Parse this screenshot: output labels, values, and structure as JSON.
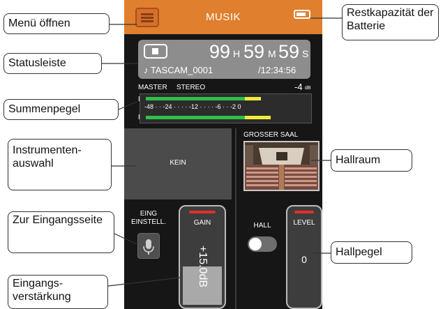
{
  "header": {
    "title": "MUSIK",
    "battery_fill": 0.8
  },
  "status": {
    "hours": "99",
    "hours_unit": "H",
    "minutes": "59",
    "minutes_unit": "M",
    "seconds": "59",
    "seconds_unit": "S",
    "file_name": "♪ TASCAM_0001",
    "total_time": "/12:34:56"
  },
  "meter": {
    "master_label": "MASTER",
    "mode_label": "STEREO",
    "peak_value": "-4",
    "peak_unit": "dB",
    "channel_l": "L",
    "channel_r": "R",
    "scale": "-48 · · -24 · · · · -12 · · · · -6 · · -2 0",
    "level_l": 0.72,
    "level_r": 0.78
  },
  "instrument": {
    "value": "KEIN"
  },
  "reverb": {
    "room_label": "GROSSER SAAL",
    "hall_label": "HALL",
    "hall_on": false,
    "level_label": "LEVEL",
    "level_value": "0"
  },
  "input": {
    "settings_label_1": "EING",
    "settings_label_2": "EINSTELL.",
    "gain_label": "GAIN",
    "gain_value": "+15.0dB",
    "gain_fill": 0.38
  },
  "callouts": {
    "menu": "Menü öffnen",
    "battery": "Restkapazität der Batterie",
    "status": "Statusleiste",
    "meter": "Summenpegel",
    "instrument": "Instrumenten-auswahl",
    "hall_room": "Hallraum",
    "input_page": "Zur Eingangsseite",
    "hall_level": "Hallpegel",
    "gain": "Eingangs-verstärkung"
  },
  "colors": {
    "accent": "#e07f2e",
    "meter_green": "#2fbf4a",
    "meter_yellow": "#f2e93c",
    "meter_orange": "#f0a02c",
    "slider_cap": "#e0302a"
  }
}
